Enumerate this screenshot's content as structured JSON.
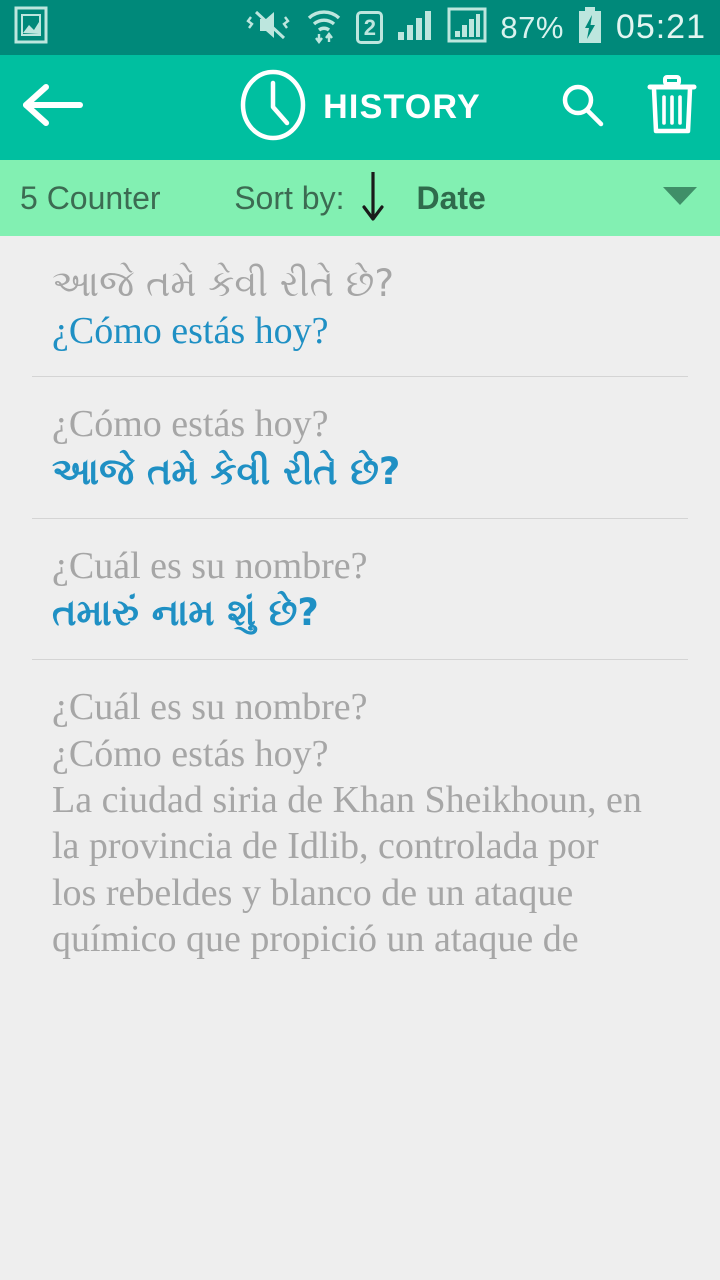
{
  "status_bar": {
    "background": "#00897a",
    "icons": [
      "image-icon",
      "mute-vibrate-icon",
      "wifi-icon",
      "sim2-icon",
      "signal-icon",
      "signal2-icon"
    ],
    "sim_label": "2",
    "battery_percent": "87%",
    "time": "05:21"
  },
  "app_bar": {
    "background": "#00bfa0",
    "back_icon": "back-arrow-icon",
    "clock_icon": "clock-icon",
    "title": "HISTORY",
    "search_icon": "search-icon",
    "delete_icon": "trash-icon"
  },
  "sort_bar": {
    "background": "#82f0b2",
    "counter": "5 Counter",
    "sort_label": "Sort by:",
    "direction_icon": "arrow-down-icon",
    "sort_value": "Date",
    "caret_icon": "chevron-down-icon"
  },
  "colors": {
    "accent_blue": "#1f90c4",
    "muted_gray": "#a6a6a6",
    "list_background": "#eeeeee",
    "divider": "#d4d4d4"
  },
  "history": {
    "items": [
      {
        "source_lines": [
          "આજે તમે કેવી રીતે છે?"
        ],
        "source_script": "gujarati",
        "target_lines": [
          "¿Cómo estás hoy?"
        ],
        "target_script": "latin"
      },
      {
        "source_lines": [
          "¿Cómo estás hoy?"
        ],
        "source_script": "latin",
        "target_lines": [
          "આજે તમે કેવી રીતે છે?"
        ],
        "target_script": "gujarati"
      },
      {
        "source_lines": [
          "¿Cuál es su nombre?"
        ],
        "source_script": "latin",
        "target_lines": [
          "તમારું નામ શું છે?"
        ],
        "target_script": "gujarati"
      },
      {
        "source_lines": [
          "¿Cuál es su nombre?",
          "¿Cómo estás hoy?",
          "La ciudad siria de Khan Sheikhoun, en",
          "la provincia de Idlib, controlada por",
          "los rebeldes y blanco de un ataque",
          "químico que propició un ataque de"
        ],
        "source_script": "latin",
        "target_lines": [],
        "target_script": "latin"
      }
    ]
  }
}
